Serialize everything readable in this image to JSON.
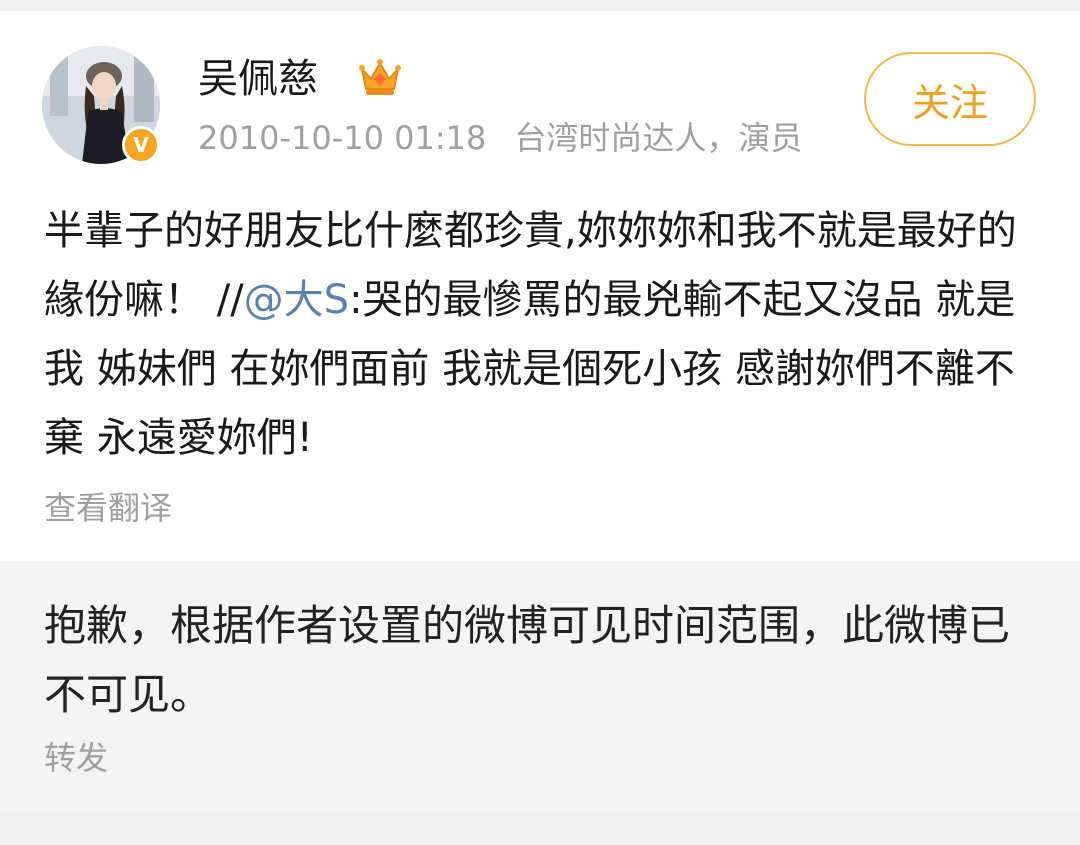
{
  "post": {
    "author": "吴佩慈",
    "timestamp": "2010-10-10 01:18",
    "author_title": "台湾时尚达人，演员",
    "follow_label": "关注",
    "text_before": "半輩子的好朋友比什麼都珍貴,妳妳妳和我不就是最好的緣份嘛！  //",
    "mention": "@大S",
    "text_after": ":哭的最慘罵的最兇輸不起又沒品 就是我 姊妹們 在妳們面前 我就是個死小孩 感謝妳們不離不棄 永遠愛妳們!",
    "translate_label": "查看翻译",
    "icons": {
      "avatar": "avatar",
      "verified": "verified-badge-icon",
      "crown": "crown-icon"
    }
  },
  "repost": {
    "unavailable_text": "抱歉，根据作者设置的微博可见时间范围，此微博已不可见。",
    "forward_label": "转发"
  },
  "colors": {
    "accent": "#f0a020",
    "mention": "#5b80b2",
    "muted": "#a0a0a0",
    "background": "#f2f2f2"
  }
}
